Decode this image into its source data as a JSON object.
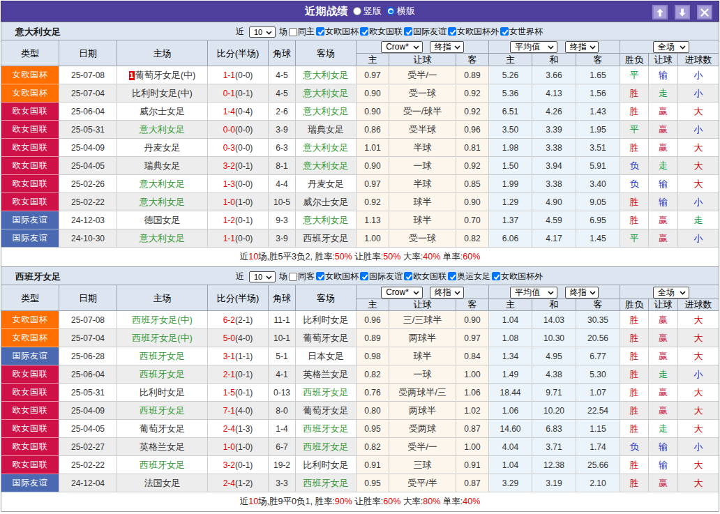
{
  "titlebar": {
    "title": "近期战绩",
    "radio_vertical": "竖版",
    "radio_horizontal": "横版",
    "selected_layout": "横版",
    "buttons": [
      "move-up",
      "move-down",
      "close"
    ],
    "bar_color": "#4e3f9d",
    "button_color": "#a89fd8"
  },
  "badge_colors": {
    "女欧国杯": "#ff6e00",
    "欧女国联": "#ce1248",
    "国际友谊": "#4a69b0"
  },
  "result_colors": {
    "胜": "red",
    "平": "green",
    "负": "blue",
    "赢": "rose",
    "走": "green",
    "输": "blue",
    "大": "red",
    "小": "blue"
  },
  "result_palette": {
    "red": "#cc0000",
    "rose": "#cc3355",
    "green": "#009933",
    "blue": "#2233cc"
  },
  "text_colors": {
    "score": "#e60000",
    "focus_team": "#339933",
    "summary_highlight": "#e60000",
    "rank_mark_bg": "#e60000"
  },
  "columns": {
    "type": "类型",
    "date": "日期",
    "home": "主场",
    "score": "比分(半场)",
    "corner": "角球",
    "away": "客场",
    "odds_home": "主",
    "odds_line": "让球",
    "odds_away": "客",
    "avg_home": "主",
    "avg_draw": "和",
    "avg_away": "客",
    "res_wl": "胜负",
    "res_handicap": "让球",
    "res_goals": "进球数"
  },
  "selects": {
    "company": "Crow*",
    "odds_time": "终指",
    "average": "平均值",
    "avg_time": "终指",
    "scope": "全场"
  },
  "tables": [
    {
      "team": "意大利女足",
      "filter": {
        "near_label": "近",
        "count": "10",
        "games_label": "场",
        "same_label": "同主",
        "comps": [
          "女欧国杯",
          "欧女国联",
          "国际友谊",
          "女欧国杯外",
          "女世界杯"
        ]
      },
      "rows": [
        {
          "comp": "女欧国杯",
          "date": "25-07-08",
          "home": "葡萄牙女足(中)",
          "home_mark": "1",
          "home_focus": false,
          "score": "1-1",
          "half": "(0-0)",
          "corner": "4-5",
          "away": "意大利女足",
          "away_focus": true,
          "o1": "0.97",
          "line": "受半/一",
          "o2": "0.89",
          "a1": "5.26",
          "a2": "3.66",
          "a3": "1.65",
          "r1": "平",
          "r2": "输",
          "r3": "小"
        },
        {
          "comp": "女欧国杯",
          "date": "25-07-04",
          "home": "比利时女足(中)",
          "home_focus": false,
          "score": "0-1",
          "half": "(0-1)",
          "corner": "4-5",
          "away": "意大利女足",
          "away_focus": true,
          "o1": "0.90",
          "line": "受一球",
          "o2": "0.92",
          "a1": "5.36",
          "a2": "4.13",
          "a3": "1.56",
          "r1": "胜",
          "r2": "走",
          "r3": "小"
        },
        {
          "comp": "欧女国联",
          "date": "25-06-04",
          "home": "威尔士女足",
          "home_focus": false,
          "score": "1-4",
          "half": "(0-4)",
          "corner": "2-6",
          "away": "意大利女足",
          "away_focus": true,
          "o1": "0.90",
          "line": "受一/球半",
          "o2": "0.92",
          "a1": "6.51",
          "a2": "4.26",
          "a3": "1.43",
          "r1": "胜",
          "r2": "赢",
          "r3": "大"
        },
        {
          "comp": "欧女国联",
          "date": "25-05-31",
          "home": "意大利女足",
          "home_focus": true,
          "score": "0-0",
          "half": "(0-0)",
          "corner": "3-9",
          "away": "瑞典女足",
          "away_focus": false,
          "o1": "0.86",
          "line": "受半球",
          "o2": "0.96",
          "a1": "3.50",
          "a2": "3.39",
          "a3": "1.95",
          "r1": "平",
          "r2": "赢",
          "r3": "小"
        },
        {
          "comp": "欧女国联",
          "date": "25-04-09",
          "home": "丹麦女足",
          "home_focus": false,
          "score": "0-3",
          "half": "(0-0)",
          "corner": "6-3",
          "away": "意大利女足",
          "away_focus": true,
          "o1": "1.01",
          "line": "半球",
          "o2": "0.81",
          "a1": "1.98",
          "a2": "3.38",
          "a3": "3.51",
          "r1": "胜",
          "r2": "赢",
          "r3": "大"
        },
        {
          "comp": "欧女国联",
          "date": "25-04-05",
          "home": "瑞典女足",
          "home_focus": false,
          "score": "3-2",
          "half": "(0-1)",
          "corner": "8-1",
          "away": "意大利女足",
          "away_focus": true,
          "o1": "0.90",
          "line": "一球",
          "o2": "0.92",
          "a1": "1.50",
          "a2": "3.94",
          "a3": "5.91",
          "r1": "负",
          "r2": "走",
          "r3": "大"
        },
        {
          "comp": "欧女国联",
          "date": "25-02-26",
          "home": "意大利女足",
          "home_focus": true,
          "score": "1-3",
          "half": "(0-0)",
          "corner": "4-4",
          "away": "丹麦女足",
          "away_focus": false,
          "o1": "0.97",
          "line": "半球",
          "o2": "0.85",
          "a1": "1.99",
          "a2": "3.38",
          "a3": "3.40",
          "r1": "负",
          "r2": "输",
          "r3": "大"
        },
        {
          "comp": "欧女国联",
          "date": "25-02-22",
          "home": "意大利女足",
          "home_focus": true,
          "score": "1-0",
          "half": "(1-0)",
          "corner": "10-5",
          "away": "威尔士女足",
          "away_focus": false,
          "o1": "0.92",
          "line": "球半",
          "o2": "0.90",
          "a1": "1.29",
          "a2": "4.90",
          "a3": "9.05",
          "r1": "胜",
          "r2": "输",
          "r3": "小"
        },
        {
          "comp": "国际友谊",
          "date": "24-12-03",
          "home": "德国女足",
          "home_focus": false,
          "score": "1-2",
          "half": "(0-1)",
          "corner": "9-3",
          "away": "意大利女足",
          "away_focus": true,
          "o1": "1.13",
          "line": "球半",
          "o2": "0.70",
          "a1": "1.37",
          "a2": "4.59",
          "a3": "6.95",
          "r1": "胜",
          "r2": "赢",
          "r3": "走"
        },
        {
          "comp": "国际友谊",
          "date": "24-10-30",
          "home": "意大利女足",
          "home_focus": true,
          "score": "1-1",
          "half": "(0-0)",
          "corner": "3-9",
          "away": "西班牙女足",
          "away_focus": false,
          "o1": "1.00",
          "line": "受一球",
          "o2": "0.82",
          "a1": "6.06",
          "a2": "4.17",
          "a3": "1.45",
          "r1": "平",
          "r2": "赢",
          "r3": "小"
        }
      ],
      "summary_parts": [
        [
          "近",
          "k"
        ],
        [
          "10",
          "r"
        ],
        [
          "场,胜5平3负2, 胜率:",
          "k"
        ],
        [
          "50%",
          "r"
        ],
        [
          " 让胜率:",
          "k"
        ],
        [
          "50%",
          "r"
        ],
        [
          " 大率:",
          "k"
        ],
        [
          "40%",
          "r"
        ],
        [
          " 单率:",
          "k"
        ],
        [
          "60%",
          "r"
        ]
      ]
    },
    {
      "team": "西班牙女足",
      "filter": {
        "near_label": "近",
        "count": "10",
        "games_label": "场",
        "same_label": "同客",
        "comps": [
          "女欧国杯",
          "国际友谊",
          "欧女国联",
          "奥运女足",
          "女欧国杯外"
        ]
      },
      "rows": [
        {
          "comp": "女欧国杯",
          "date": "25-07-08",
          "home": "西班牙女足(中)",
          "home_focus": true,
          "score": "6-2",
          "half": "(2-1)",
          "corner": "11-1",
          "away": "比利时女足",
          "away_focus": false,
          "o1": "0.96",
          "line": "三/三球半",
          "o2": "0.90",
          "a1": "1.04",
          "a2": "14.03",
          "a3": "30.35",
          "r1": "胜",
          "r2": "赢",
          "r3": "大"
        },
        {
          "comp": "女欧国杯",
          "date": "25-07-04",
          "home": "西班牙女足(中)",
          "home_focus": true,
          "score": "5-0",
          "half": "(4-0)",
          "corner": "10-1",
          "away": "葡萄牙女足",
          "away_focus": false,
          "o1": "0.89",
          "line": "两球半",
          "o2": "0.97",
          "a1": "1.08",
          "a2": "10.30",
          "a3": "20.56",
          "r1": "胜",
          "r2": "赢",
          "r3": "大"
        },
        {
          "comp": "国际友谊",
          "date": "25-06-28",
          "home": "西班牙女足",
          "home_focus": true,
          "score": "3-1",
          "half": "(1-1)",
          "corner": "5-1",
          "away": "日本女足",
          "away_focus": false,
          "o1": "0.98",
          "line": "球半",
          "o2": "0.84",
          "a1": "1.34",
          "a2": "4.95",
          "a3": "6.77",
          "r1": "胜",
          "r2": "赢",
          "r3": "大"
        },
        {
          "comp": "欧女国联",
          "date": "25-06-04",
          "home": "西班牙女足",
          "home_focus": true,
          "score": "2-1",
          "half": "(0-1)",
          "corner": "4-1",
          "away": "英格兰女足",
          "away_focus": false,
          "o1": "0.82",
          "line": "一球",
          "o2": "1.00",
          "a1": "1.49",
          "a2": "4.38",
          "a3": "5.30",
          "r1": "胜",
          "r2": "走",
          "r3": "小"
        },
        {
          "comp": "欧女国联",
          "date": "25-05-31",
          "home": "比利时女足",
          "home_focus": false,
          "score": "1-5",
          "half": "(0-1)",
          "corner": "0-13",
          "away": "西班牙女足",
          "away_focus": true,
          "o1": "0.76",
          "line": "受两球半/三",
          "o2": "1.06",
          "a1": "18.44",
          "a2": "9.71",
          "a3": "1.07",
          "r1": "胜",
          "r2": "赢",
          "r3": "大"
        },
        {
          "comp": "欧女国联",
          "date": "25-04-09",
          "home": "西班牙女足",
          "home_focus": true,
          "score": "7-1",
          "half": "(4-0)",
          "corner": "8-0",
          "away": "葡萄牙女足",
          "away_focus": false,
          "o1": "0.80",
          "line": "两球半",
          "o2": "1.02",
          "a1": "1.06",
          "a2": "10.20",
          "a3": "22.54",
          "r1": "胜",
          "r2": "赢",
          "r3": "大"
        },
        {
          "comp": "欧女国联",
          "date": "25-04-05",
          "home": "葡萄牙女足",
          "home_focus": false,
          "score": "2-4",
          "half": "(1-3)",
          "corner": "1-4",
          "away": "西班牙女足",
          "away_focus": true,
          "o1": "0.95",
          "line": "受两球",
          "o2": "0.87",
          "a1": "14.60",
          "a2": "6.83",
          "a3": "1.15",
          "r1": "胜",
          "r2": "走",
          "r3": "大"
        },
        {
          "comp": "欧女国联",
          "date": "25-02-27",
          "home": "英格兰女足",
          "home_focus": false,
          "score": "1-0",
          "half": "(1-0)",
          "corner": "6-7",
          "away": "西班牙女足",
          "away_focus": true,
          "o1": "0.82",
          "line": "受半/一",
          "o2": "1.00",
          "a1": "4.04",
          "a2": "3.71",
          "a3": "1.74",
          "r1": "负",
          "r2": "输",
          "r3": "小"
        },
        {
          "comp": "欧女国联",
          "date": "25-02-22",
          "home": "西班牙女足",
          "home_focus": true,
          "score": "3-2",
          "half": "(0-1)",
          "corner": "19-2",
          "away": "比利时女足",
          "away_focus": false,
          "o1": "0.91",
          "line": "三球",
          "o2": "0.91",
          "a1": "1.04",
          "a2": "12.38",
          "a3": "25.66",
          "r1": "胜",
          "r2": "输",
          "r3": "大"
        },
        {
          "comp": "国际友谊",
          "date": "24-12-04",
          "home": "法国女足",
          "home_focus": false,
          "score": "2-4",
          "half": "(1-2)",
          "corner": "3-3",
          "away": "西班牙女足",
          "away_focus": true,
          "o1": "0.95",
          "line": "受平/半",
          "o2": "0.87",
          "a1": "3.29",
          "a2": "3.19",
          "a3": "2.10",
          "r1": "胜",
          "r2": "赢",
          "r3": "大"
        }
      ],
      "summary_parts": [
        [
          "近",
          "k"
        ],
        [
          "10",
          "r"
        ],
        [
          "场,胜9平0负1, 胜率:",
          "k"
        ],
        [
          "90%",
          "r"
        ],
        [
          " 让胜率:",
          "k"
        ],
        [
          "60%",
          "r"
        ],
        [
          " 大率:",
          "k"
        ],
        [
          "80%",
          "r"
        ],
        [
          " 单率:",
          "k"
        ],
        [
          "40%",
          "r"
        ]
      ]
    }
  ]
}
